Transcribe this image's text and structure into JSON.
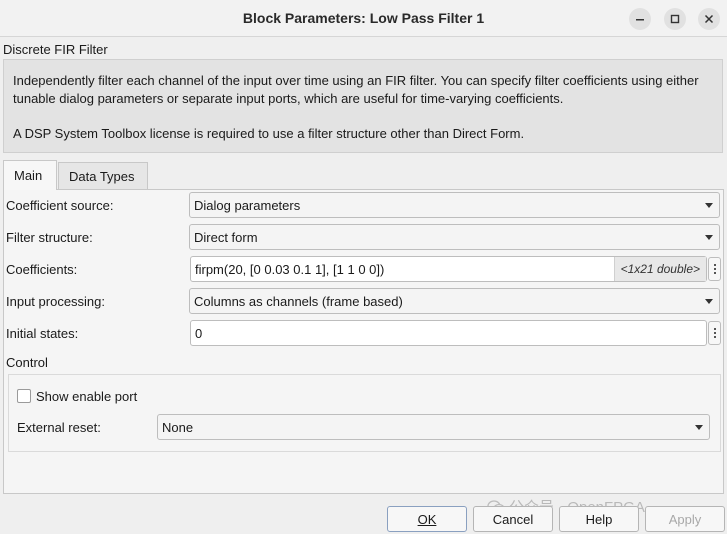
{
  "window": {
    "title": "Block Parameters: Low Pass Filter 1"
  },
  "block_type": "Discrete FIR Filter",
  "description": {
    "line1": "Independently filter each channel of the input over time using an FIR filter. You can specify filter coefficients using either tunable dialog parameters or separate input ports, which are useful for time-varying coefficients.",
    "line2": "A DSP System Toolbox license is required to use a filter structure other than Direct Form."
  },
  "tabs": [
    {
      "label": "Main",
      "selected": true
    },
    {
      "label": "Data Types",
      "selected": false
    }
  ],
  "params": {
    "coefficient_source": {
      "label": "Coefficient source:",
      "value": "Dialog parameters"
    },
    "filter_structure": {
      "label": "Filter structure:",
      "value": "Direct form"
    },
    "coefficients": {
      "label": "Coefficients:",
      "value": "firpm(20, [0 0.03 0.1 1], [1 1 0 0])",
      "type_hint": "<1x21 double>"
    },
    "input_processing": {
      "label": "Input processing:",
      "value": "Columns as channels (frame based)"
    },
    "initial_states": {
      "label": "Initial states:",
      "value": "0"
    }
  },
  "control": {
    "title": "Control",
    "show_enable_port": {
      "label": "Show enable port",
      "checked": false
    },
    "external_reset": {
      "label": "External reset:",
      "value": "None"
    }
  },
  "buttons": {
    "ok": "OK",
    "cancel": "Cancel",
    "help": "Help",
    "apply": "Apply"
  },
  "watermark": {
    "text": "公众号 · OpenFPGA"
  },
  "icons": {
    "minimize": "minimize-icon",
    "maximize": "maximize-icon",
    "close": "close-icon",
    "dropdown": "chevron-down-icon",
    "more": "more-options-icon",
    "watermark": "wechat-icon"
  }
}
